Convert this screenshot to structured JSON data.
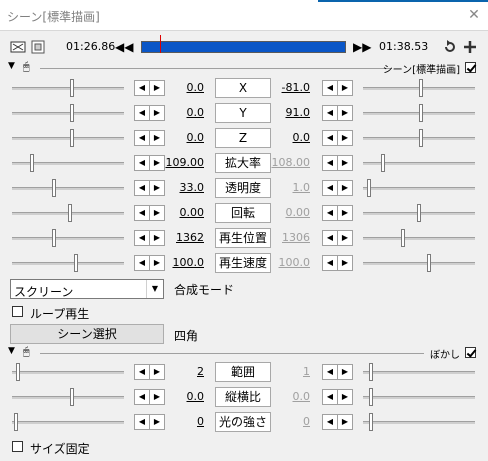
{
  "window": {
    "title": "シーン[標準描画]",
    "close_glyph": "✕"
  },
  "timeline": {
    "start_time": "01:26.86",
    "end_time": "01:38.53",
    "bar_color": "#0a56c7",
    "marker_color": "#dd0000"
  },
  "section1": {
    "name": "シーン[標準描画]",
    "checked": true
  },
  "params1": [
    {
      "label": "X",
      "value": "0.0",
      "end": "-81.0",
      "end_dim": false
    },
    {
      "label": "Y",
      "value": "0.0",
      "end": "91.0",
      "end_dim": false
    },
    {
      "label": "Z",
      "value": "0.0",
      "end": "0.0",
      "end_dim": false
    },
    {
      "label": "拡大率",
      "value": "109.00",
      "end": "108.00",
      "end_dim": true
    },
    {
      "label": "透明度",
      "value": "33.0",
      "end": "1.0",
      "end_dim": true
    },
    {
      "label": "回転",
      "value": "0.00",
      "end": "0.00",
      "end_dim": true
    },
    {
      "label": "再生位置",
      "value": "1362",
      "end": "1306",
      "end_dim": true
    },
    {
      "label": "再生速度",
      "value": "100.0",
      "end": "100.0",
      "end_dim": true
    }
  ],
  "blend": {
    "selected": "スクリーン",
    "label": "合成モード"
  },
  "loop": {
    "label": "ループ再生",
    "checked": false
  },
  "scene": {
    "button": "シーン選択",
    "value": "四角"
  },
  "section2": {
    "name": "ぼかし",
    "checked": true
  },
  "params2": [
    {
      "label": "範囲",
      "value": "2",
      "end": "1",
      "end_dim": true
    },
    {
      "label": "縦横比",
      "value": "0.0",
      "end": "0.0",
      "end_dim": true
    },
    {
      "label": "光の強さ",
      "value": "0",
      "end": "0",
      "end_dim": true
    }
  ],
  "size_fixed": {
    "label": "サイズ固定",
    "checked": false
  },
  "icons": {
    "left": "left-arrow-icon",
    "right": "right-arrow-icon"
  }
}
